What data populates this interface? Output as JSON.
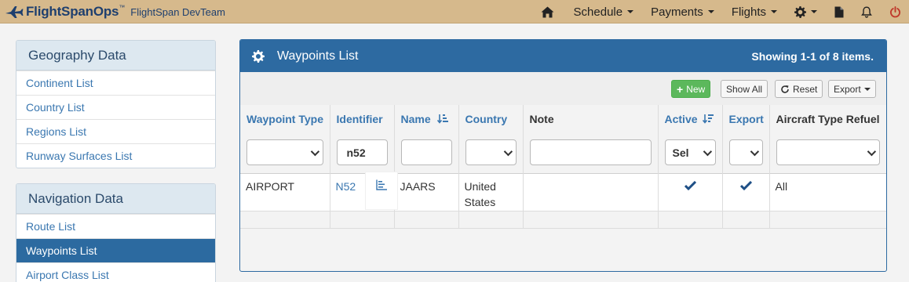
{
  "app": {
    "brand": "FlightSpanOps",
    "brand_tm": "™",
    "team": "FlightSpan DevTeam"
  },
  "nav": {
    "schedule": "Schedule",
    "payments": "Payments",
    "flights": "Flights"
  },
  "sidebar": {
    "geography": {
      "title": "Geography Data",
      "items": [
        "Continent List",
        "Country List",
        "Regions List",
        "Runway Surfaces List"
      ]
    },
    "navigation": {
      "title": "Navigation Data",
      "items": [
        "Route List",
        "Waypoints List",
        "Airport Class List"
      ],
      "active": "Waypoints List"
    }
  },
  "main": {
    "title": "Waypoints List",
    "summary": "Showing 1-1 of 8 items.",
    "toolbar": {
      "new": "New",
      "show_all": "Show All",
      "reset": "Reset",
      "export": "Export"
    },
    "columns": [
      "Waypoint Type",
      "Identifier",
      "Name",
      "Country",
      "Note",
      "Active",
      "Export",
      "Aircraft Type Refuel"
    ],
    "filters": {
      "identifier": "n52",
      "active": "Sel"
    },
    "rows": [
      {
        "waypoint_type": "AIRPORT",
        "identifier": "N52",
        "name": "JAARS",
        "country_line1": "United",
        "country_line2": "States",
        "note": "",
        "active": "✔",
        "export": "✔",
        "aircraft_type_refuel": "All"
      }
    ]
  },
  "colors": {
    "navbar": "#d6b98c",
    "primary": "#2d6aa1",
    "link": "#3a77b0",
    "success": "#5cb85c"
  }
}
